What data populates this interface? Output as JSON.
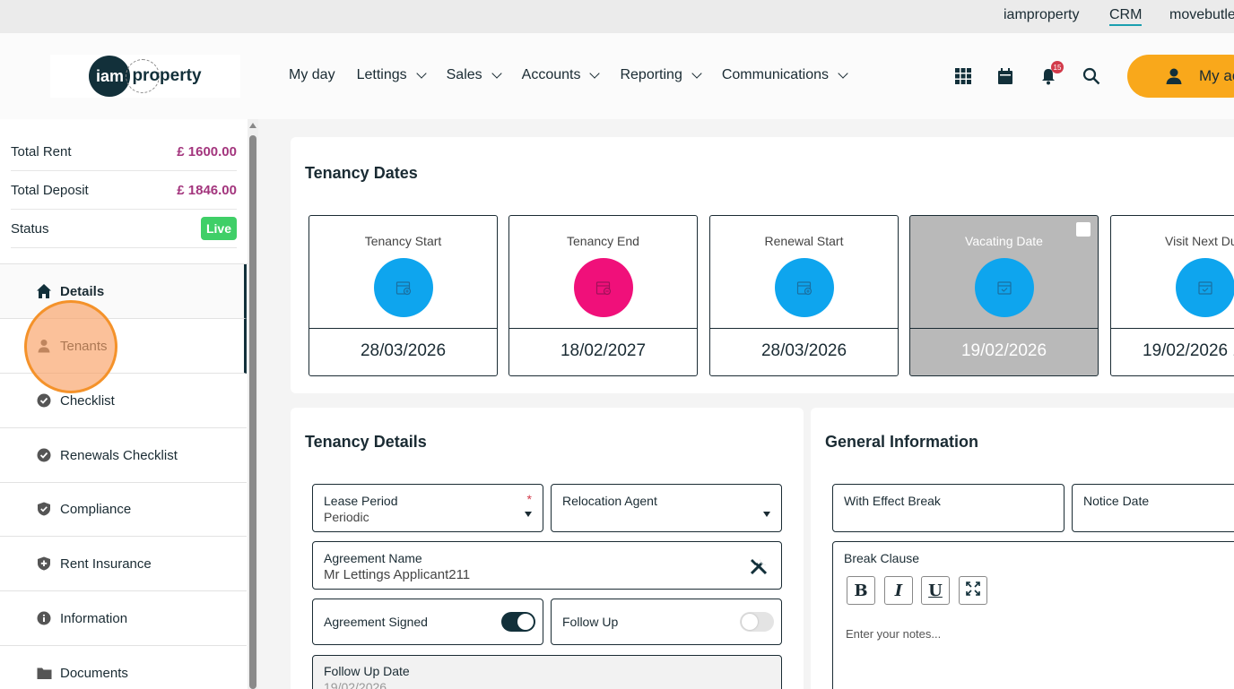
{
  "topbar": {
    "links": [
      "iamproperty",
      "CRM",
      "movebutler"
    ]
  },
  "header": {
    "logo_text_left": "iam",
    "logo_text_right": "property",
    "nav": [
      {
        "label": "My day"
      },
      {
        "label": "Lettings"
      },
      {
        "label": "Sales"
      },
      {
        "label": "Accounts"
      },
      {
        "label": "Reporting"
      },
      {
        "label": "Communications"
      }
    ],
    "notification_count": "15",
    "account_label": "My ac"
  },
  "sidebar": {
    "summary": [
      {
        "label": "Total Rent",
        "value": "£ 1600.00"
      },
      {
        "label": "Total Deposit",
        "value": "£ 1846.00"
      },
      {
        "label": "Status",
        "value": "Live"
      }
    ],
    "menu": [
      {
        "label": "Details",
        "icon": "home-icon"
      },
      {
        "label": "Tenants",
        "icon": "person-icon"
      },
      {
        "label": "Checklist",
        "icon": "check-circle-icon"
      },
      {
        "label": "Renewals Checklist",
        "icon": "check-circle-icon"
      },
      {
        "label": "Compliance",
        "icon": "shield-check-icon"
      },
      {
        "label": "Rent Insurance",
        "icon": "shield-plus-icon"
      },
      {
        "label": "Information",
        "icon": "info-icon"
      },
      {
        "label": "Documents",
        "icon": "folder-icon"
      }
    ]
  },
  "tenancy_dates": {
    "title": "Tenancy Dates",
    "items": [
      {
        "label": "Tenancy Start",
        "date": "28/03/2026",
        "color": "#0ea5ee"
      },
      {
        "label": "Tenancy End",
        "date": "18/02/2027",
        "color": "#f0107a"
      },
      {
        "label": "Renewal Start",
        "date": "28/03/2026",
        "color": "#0ea5ee"
      },
      {
        "label": "Vacating Date",
        "date": "19/02/2026",
        "color": "#0ea5ee"
      },
      {
        "label": "Visit Next Du",
        "date": "19/02/2026 1",
        "color": "#0ea5ee"
      }
    ]
  },
  "tenancy_details": {
    "title": "Tenancy Details",
    "lease_period_label": "Lease Period",
    "lease_period_value": "Periodic",
    "required_mark": "*",
    "relocation_agent_label": "Relocation Agent",
    "agreement_name_label": "Agreement Name",
    "agreement_name_value": "Mr Lettings Applicant211",
    "agreement_signed_label": "Agreement Signed",
    "agreement_signed": true,
    "follow_up_label": "Follow Up",
    "follow_up": false,
    "follow_up_date_label": "Follow Up Date",
    "follow_up_date_value": "19/02/2026"
  },
  "general_information": {
    "title": "General Information",
    "with_effect_break_label": "With Effect Break",
    "notice_date_label": "Notice Date",
    "break_clause_label": "Break Clause",
    "format_buttons": [
      "B",
      "I",
      "U"
    ],
    "notes_placeholder": "Enter your notes..."
  }
}
